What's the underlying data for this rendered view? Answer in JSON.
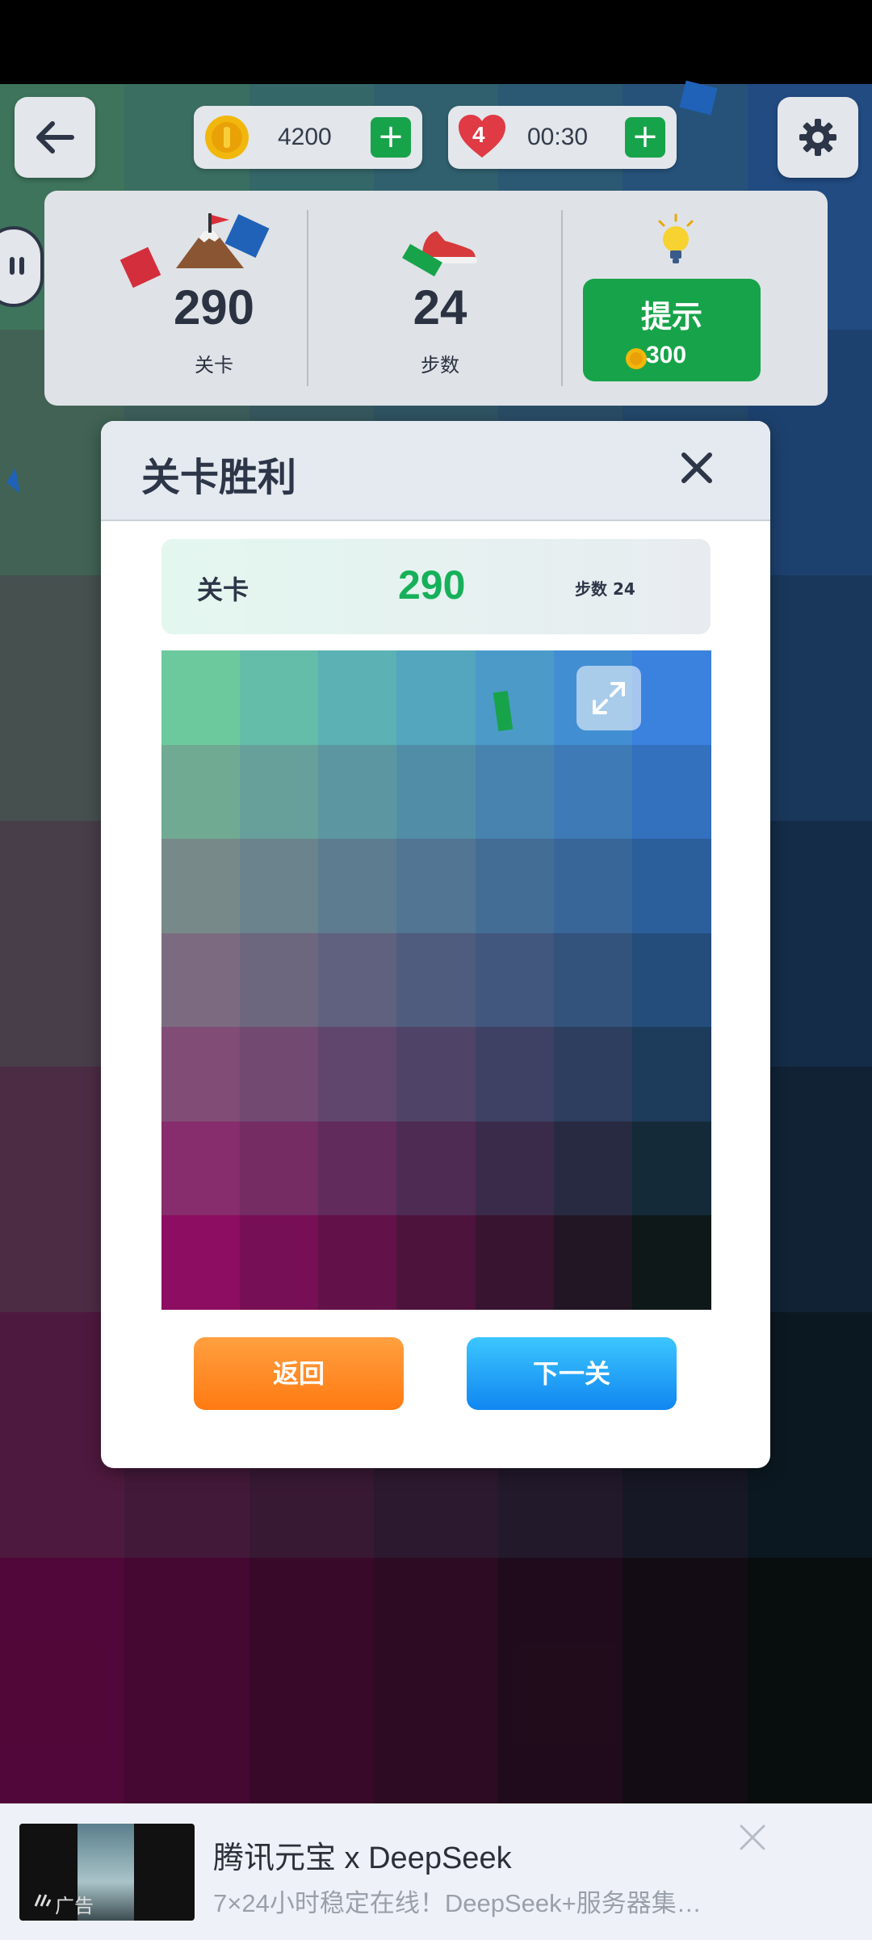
{
  "hud": {
    "coins": "4200",
    "lives": "4",
    "timer": "00:30",
    "plus": "+"
  },
  "stats": {
    "level_value": "290",
    "level_label": "关卡",
    "steps_value": "24",
    "steps_label": "步数",
    "hint_label": "提示",
    "hint_cost": "300"
  },
  "modal": {
    "title": "关卡胜利",
    "info_label": "关卡",
    "info_level": "290",
    "info_steps": "步数 24",
    "back_button": "返回",
    "next_button": "下一关"
  },
  "ad": {
    "badge": "广告",
    "title": "腾讯元宝 x DeepSeek",
    "subtitle": "7×24小时稳定在线！DeepSeek+服务器集…"
  },
  "colors": {
    "accent_green": "#17a34a",
    "level_green": "#17b05a",
    "back_orange": "#ff8a25",
    "next_blue": "#1a9cf8",
    "board_corners": {
      "top_left": "#6cc99d",
      "top_right": "#3a82de",
      "bottom_left": "#8c0d62",
      "bottom_right": "#0e1818"
    }
  }
}
